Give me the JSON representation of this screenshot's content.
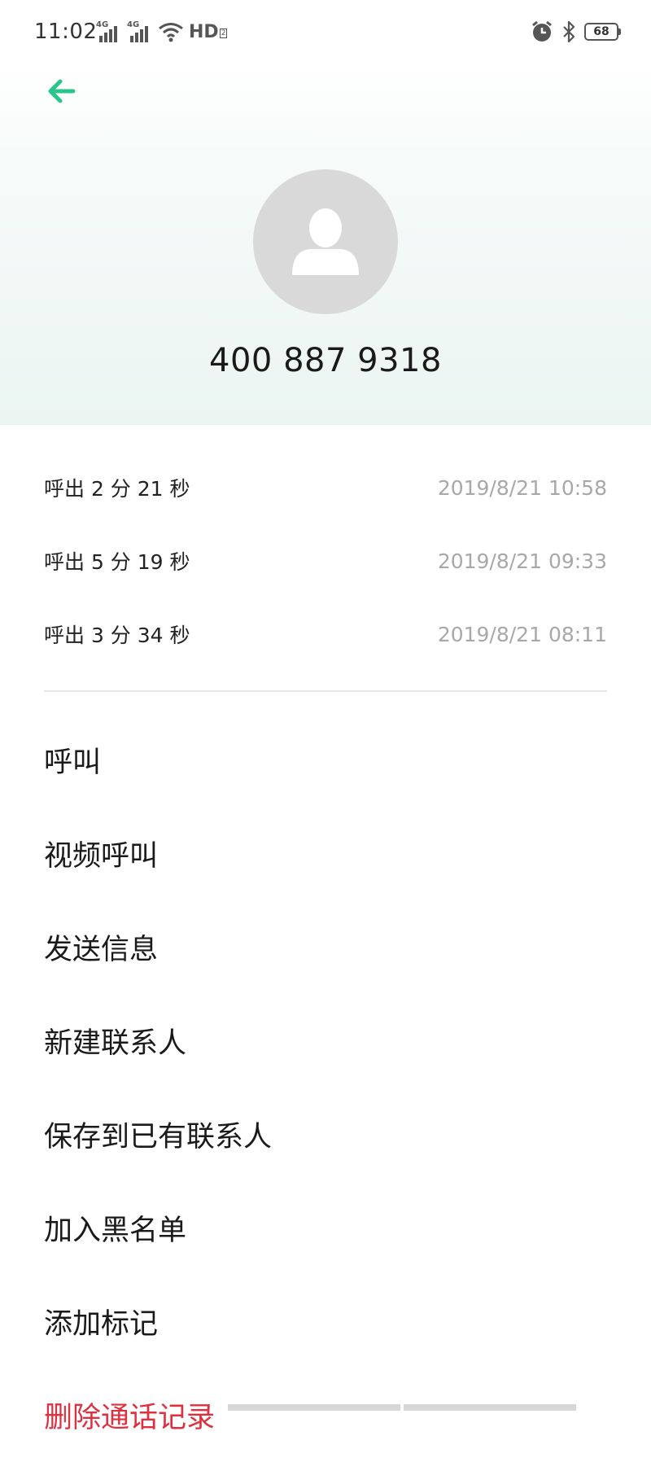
{
  "status_bar": {
    "time": "11:02",
    "signal1_tag": "4G",
    "signal2_tag": "4G",
    "hd_label": "HD",
    "hd_sub": "2",
    "battery_level": "68",
    "icons": [
      "signal-icon",
      "signal-icon",
      "wifi-icon",
      "hd-icon",
      "alarm-icon",
      "bluetooth-icon",
      "battery-icon"
    ]
  },
  "header": {
    "back_icon": "back-arrow-icon",
    "accent_color": "#2bc58a",
    "avatar_icon": "person-silhouette-icon",
    "phone_number": "400 887 9318"
  },
  "call_log": [
    {
      "description": "呼出  2 分 21 秒",
      "time": "2019/8/21 10:58"
    },
    {
      "description": "呼出  5 分 19 秒",
      "time": "2019/8/21 09:33"
    },
    {
      "description": "呼出  3 分 34 秒",
      "time": "2019/8/21 08:11"
    }
  ],
  "actions": [
    {
      "label": "呼叫"
    },
    {
      "label": "视频呼叫"
    },
    {
      "label": "发送信息"
    },
    {
      "label": "新建联系人"
    },
    {
      "label": "保存到已有联系人"
    },
    {
      "label": "加入黑名单"
    },
    {
      "label": "添加标记"
    },
    {
      "label": "删除通话记录"
    }
  ],
  "colors": {
    "danger": "#e02f3f",
    "muted_text": "#a8a8a8"
  }
}
